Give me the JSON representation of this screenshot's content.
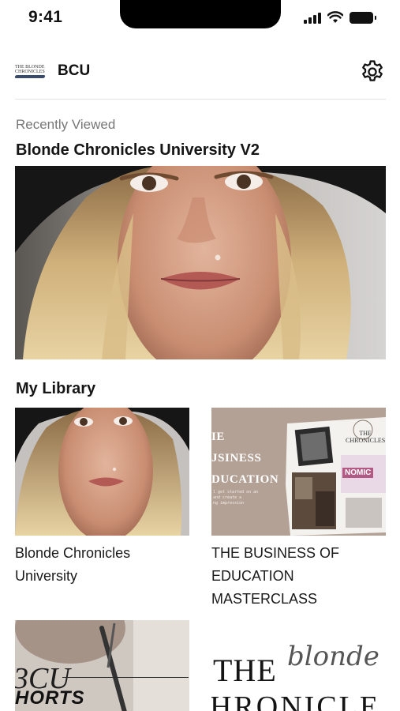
{
  "status_bar": {
    "time": "9:41"
  },
  "header": {
    "logo_line1": "THE BLONDE",
    "logo_line2": "CHRONICLES",
    "title": "BCU",
    "settings_icon": "gear-icon"
  },
  "recently_viewed": {
    "caption": "Recently Viewed",
    "title": "Blonde Chronicles University V2"
  },
  "library": {
    "heading": "My Library",
    "items": [
      {
        "title_line1": "Blonde Chronicles",
        "title_line2": "University"
      },
      {
        "title_line1": "THE BUSINESS OF",
        "title_line2": "EDUCATION",
        "title_line3": "MASTERCLASS",
        "thumb_text": {
          "line1": "IE",
          "line2": "JSINESS",
          "line3": "DUCATION",
          "small1": "l get started on an",
          "small2": "and create a",
          "small3": "ng impression",
          "badge_line1": "THE",
          "badge_line2": "CHRONICLES",
          "badge_line3": "NOMIC"
        }
      },
      {
        "thumb_text": {
          "line1": "3CU",
          "line2": "HORTS"
        }
      },
      {
        "thumb_text": {
          "the": "THE",
          "blonde": "blonde",
          "word": "HRONICLE"
        }
      }
    ]
  },
  "colors": {
    "accent_text": "#151515",
    "muted_text": "#777777",
    "card_tan": "#b3a195"
  }
}
